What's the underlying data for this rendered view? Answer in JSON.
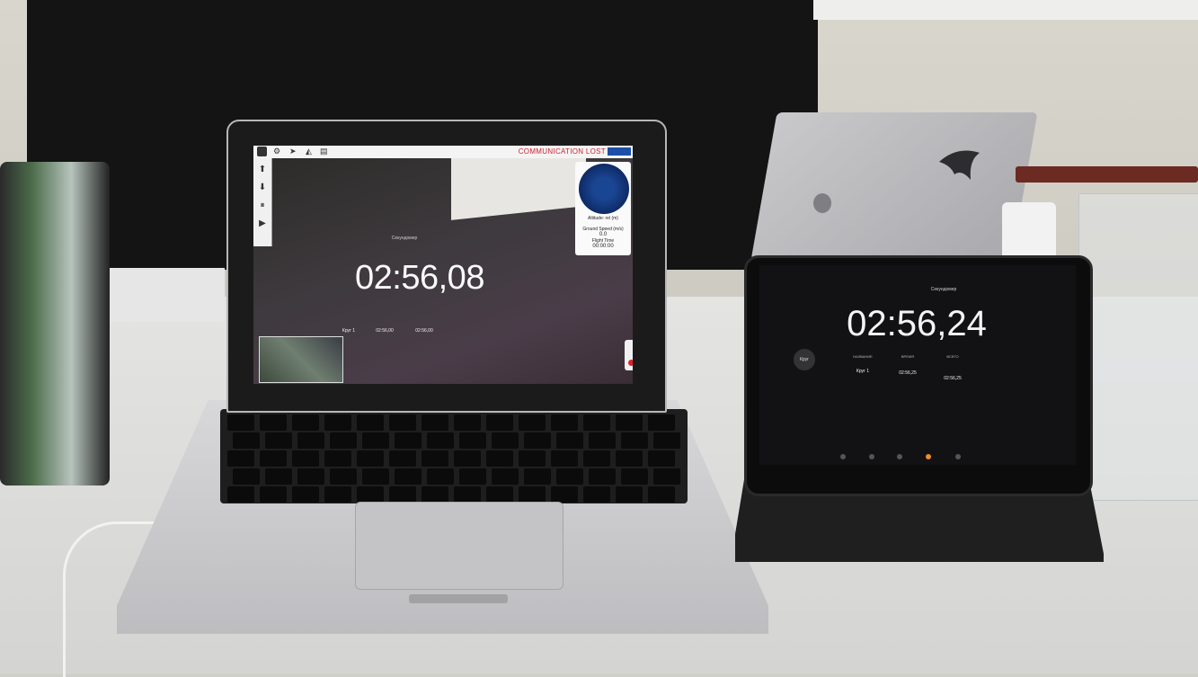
{
  "laptop": {
    "app": {
      "status_banner": "COMMUNICATION LOST",
      "hud": {
        "altitude_label": "Altitude: rel (m)",
        "ground_speed_label": "Ground Speed (m/s)",
        "ground_speed_value": "0.0",
        "flight_time_label": "Flight Time",
        "flight_time_value": "00:00:00"
      }
    },
    "stopwatch": {
      "title": "Секундомер",
      "time": "02:56,08",
      "laps": [
        {
          "col": "Круг 1",
          "value": "02:56,00"
        },
        {
          "col": "02:56,00",
          "value": "02:56,00"
        }
      ]
    }
  },
  "ipad": {
    "stopwatch": {
      "title": "Секундомер",
      "time": "02:56,24",
      "lap_button": "Круг",
      "lap_headers": [
        "НАЗВАНИЕ",
        "ВРЕМЯ",
        "ВСЕГО"
      ],
      "laps": [
        "Круг 1",
        "02:56,25",
        "02:56,25"
      ]
    }
  },
  "colors": {
    "alert_red": "#d0202f",
    "accent_blue": "#1d4fa8",
    "active_tab": "#f08a2a"
  }
}
